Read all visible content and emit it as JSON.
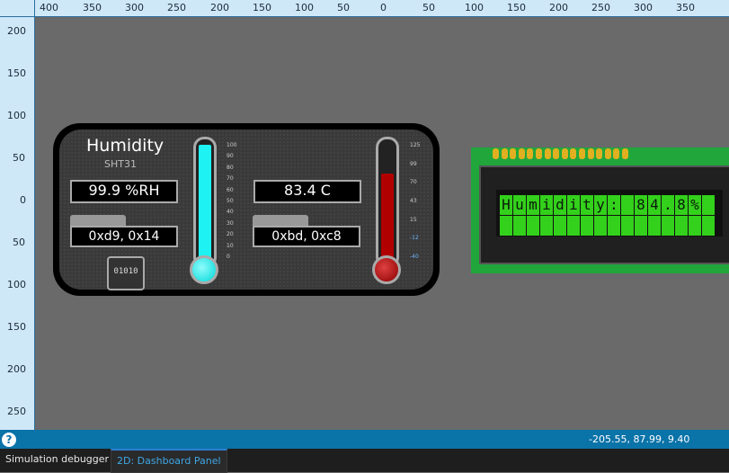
{
  "rulers": {
    "top": [
      "400",
      "350",
      "300",
      "250",
      "200",
      "150",
      "100",
      "50",
      "0",
      "50",
      "100",
      "150",
      "200",
      "250",
      "300",
      "350"
    ],
    "left": [
      "200",
      "150",
      "100",
      "50",
      "0",
      "50",
      "100",
      "150",
      "200",
      "250"
    ]
  },
  "dashboard": {
    "title": "Humidity",
    "subtitle": "SHT31",
    "humidity_value": "99.9 %RH",
    "humidity_hex": "0xd9, 0x14",
    "temp_value": "83.4 C",
    "temp_hex": "0xbd, 0xc8",
    "chip_label": "01010",
    "humidity_scale": [
      "100",
      "90",
      "80",
      "70",
      "60",
      "50",
      "40",
      "30",
      "20",
      "10",
      "0"
    ],
    "humidity_level": 1.0,
    "temp_scale": [
      "125",
      "99",
      "70",
      "43",
      "15",
      "-12",
      "-40"
    ],
    "temp_level": 0.75
  },
  "lcd": {
    "row1": [
      "H",
      "u",
      "m",
      "i",
      "d",
      "i",
      "t",
      "y",
      ":",
      " ",
      "8",
      "4",
      ".",
      "8",
      "%",
      " "
    ],
    "row2": [
      " ",
      " ",
      " ",
      " ",
      " ",
      " ",
      " ",
      " ",
      " ",
      " ",
      " ",
      " ",
      " ",
      " ",
      " ",
      " "
    ]
  },
  "status": {
    "help_icon": "?",
    "coords": "-205.55, 87.99, 9.40"
  },
  "tabs": [
    "Simulation debugger",
    "2D: Dashboard Panel"
  ]
}
